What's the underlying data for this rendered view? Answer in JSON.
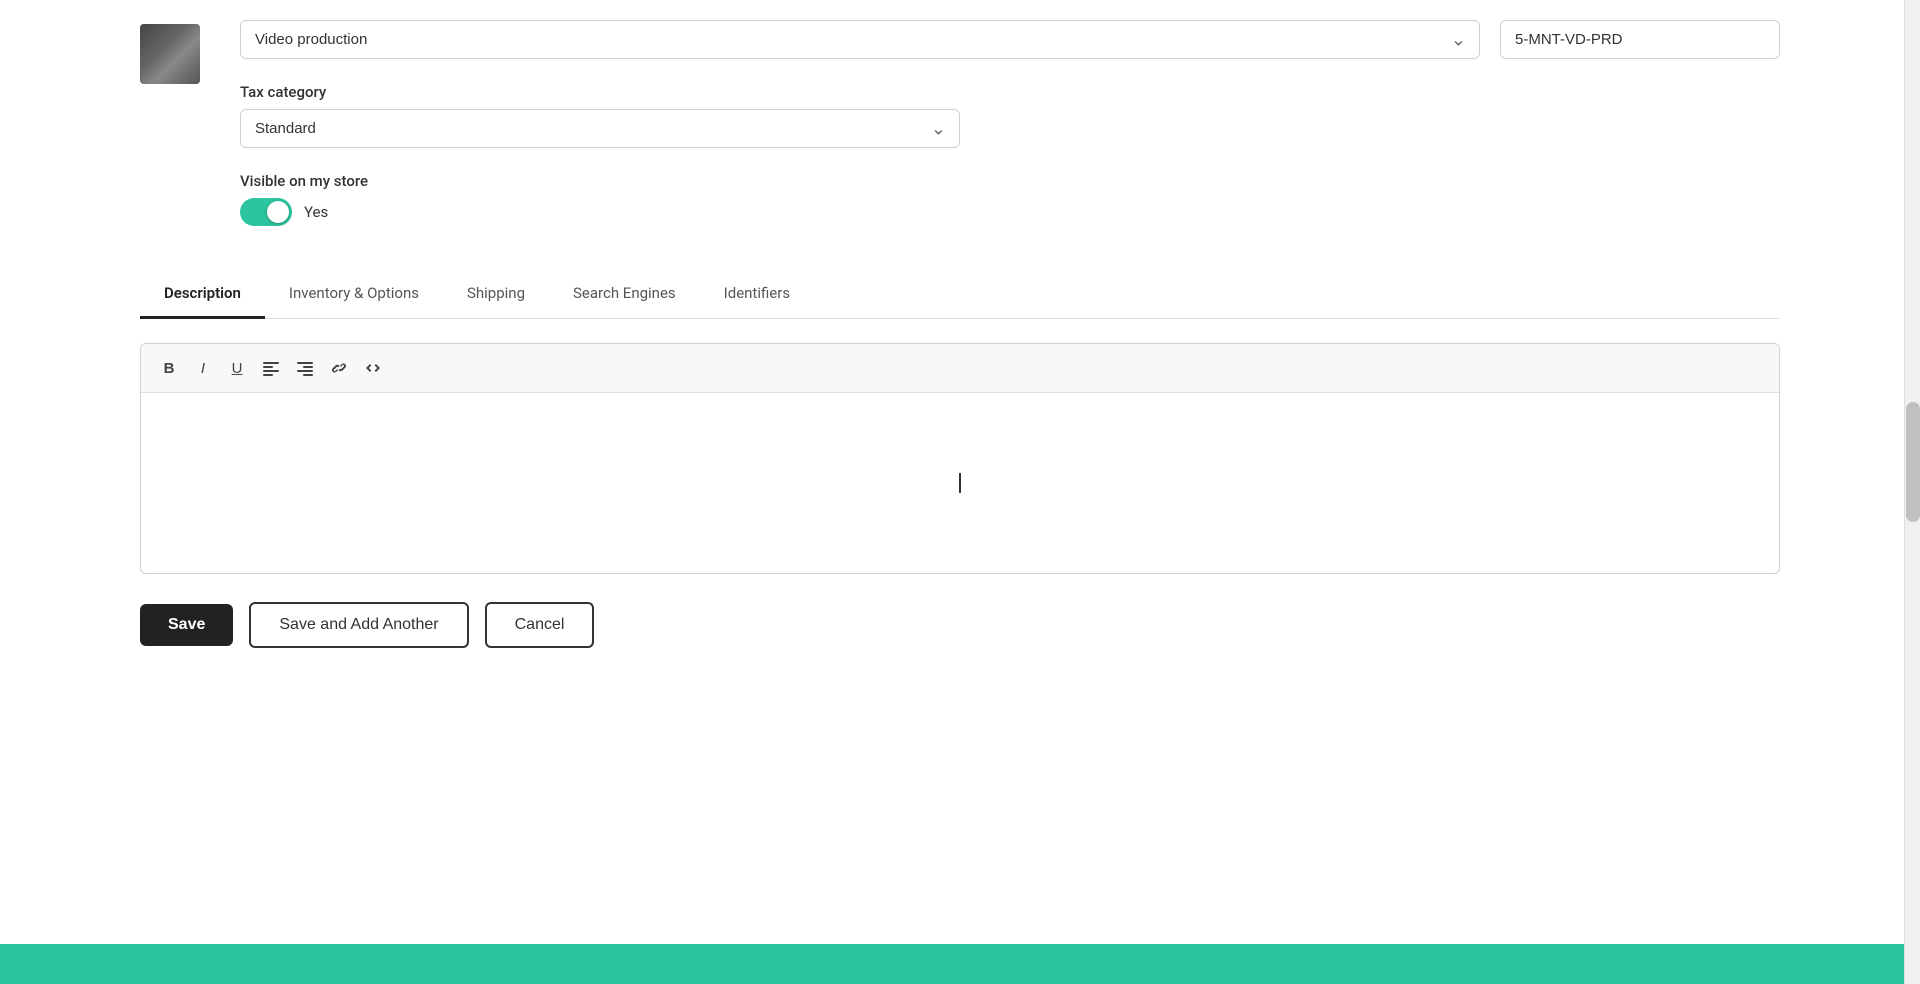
{
  "topFields": {
    "categoryValue": "Video production",
    "skuValue": "5-MNT-VD-PRD",
    "taxCategoryLabel": "Tax category",
    "taxCategoryValue": "Standard",
    "visibleLabel": "Visible on my store",
    "visibleToggleState": "Yes"
  },
  "tabs": [
    {
      "id": "description",
      "label": "Description",
      "active": true
    },
    {
      "id": "inventory-options",
      "label": "Inventory & Options",
      "active": false
    },
    {
      "id": "shipping",
      "label": "Shipping",
      "active": false
    },
    {
      "id": "search-engines",
      "label": "Search Engines",
      "active": false
    },
    {
      "id": "identifiers",
      "label": "Identifiers",
      "active": false
    }
  ],
  "toolbar": {
    "boldLabel": "B",
    "italicLabel": "I",
    "underlineLabel": "U",
    "alignLeftIcon": "align-left",
    "alignRightIcon": "align-right",
    "linkIcon": "link",
    "codeIcon": "code"
  },
  "actions": {
    "saveLabel": "Save",
    "saveAddLabel": "Save and Add Another",
    "cancelLabel": "Cancel"
  }
}
